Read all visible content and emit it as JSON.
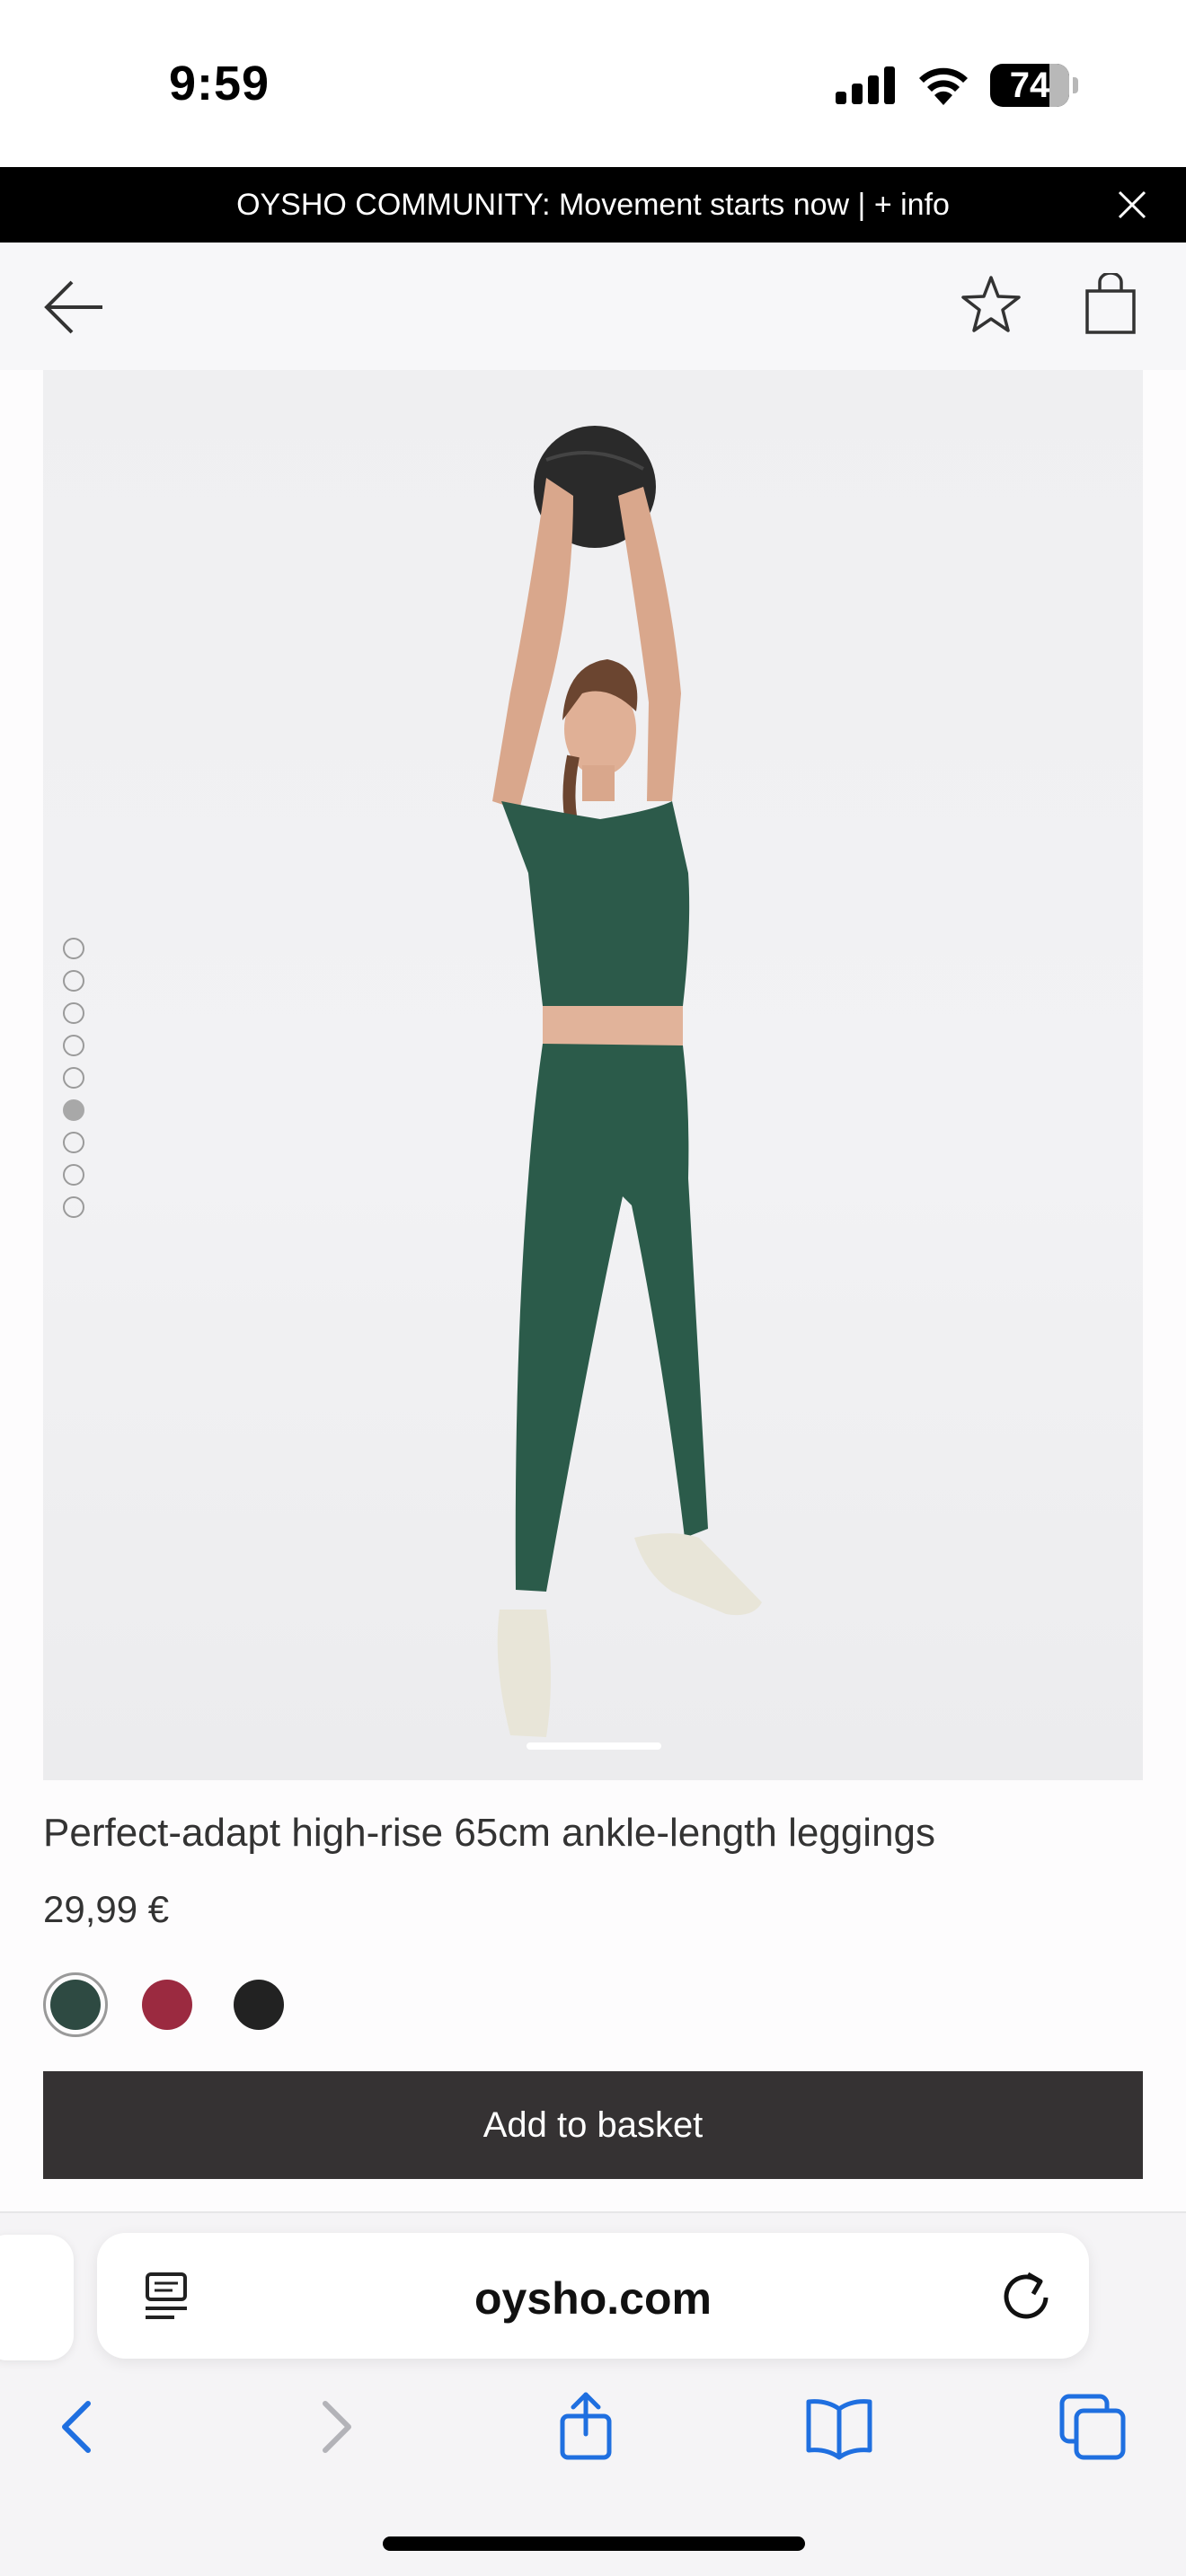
{
  "status_bar": {
    "time": "9:59",
    "battery": "74",
    "icons": [
      "signal-icon",
      "wifi-icon",
      "battery-icon"
    ]
  },
  "promo_banner": {
    "text": "OYSHO COMMUNITY: Movement starts now | + info",
    "icon": "close-icon"
  },
  "header": {
    "icons": [
      "back-arrow-icon",
      "star-icon",
      "shopping-bag-icon"
    ]
  },
  "gallery": {
    "dot_count": 9,
    "active_index": 5
  },
  "product": {
    "title": "Perfect-adapt high-rise 65cm ankle-length leggings",
    "price": "29,99 €",
    "colors": [
      "#2e4a42",
      "#9b2a40",
      "#222222"
    ],
    "selected_color_index": 0,
    "add_to_basket_label": "Add to basket"
  },
  "browser": {
    "url": "oysho.com",
    "icons": [
      "reader-mode-icon",
      "reload-icon",
      "back-icon",
      "forward-icon",
      "share-icon",
      "bookmarks-icon",
      "tabs-icon"
    ],
    "accent": "#1f6fe0"
  }
}
